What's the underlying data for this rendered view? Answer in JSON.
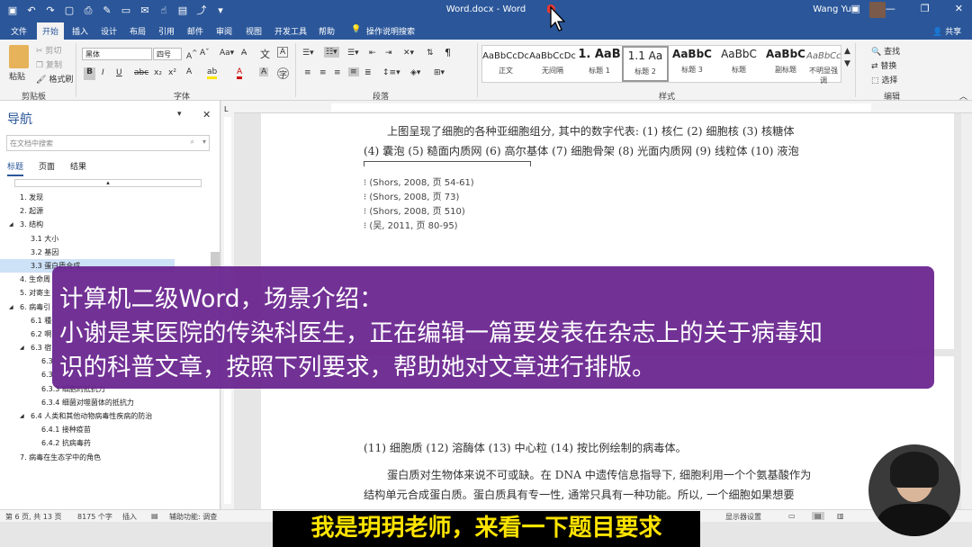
{
  "window": {
    "title": "Word.docx - Word",
    "user": "Wang Yue"
  },
  "ribbon_tabs": [
    "文件",
    "开始",
    "插入",
    "设计",
    "布局",
    "引用",
    "邮件",
    "审阅",
    "视图",
    "开发工具",
    "帮助",
    "操作说明搜索"
  ],
  "share": "共享",
  "clipboard": {
    "paste": "粘贴",
    "cut": "剪切",
    "copy": "复制",
    "painter": "格式刷",
    "label": "剪贴板"
  },
  "font": {
    "name": "黑体",
    "size": "四号",
    "label": "字体"
  },
  "paragraph_label": "段落",
  "styles": {
    "label": "样式",
    "items": [
      {
        "preview": "AaBbCcDc",
        "name": "正文"
      },
      {
        "preview": "AaBbCcDc",
        "name": "无间隔"
      },
      {
        "preview": "1. AaB",
        "name": "标题 1"
      },
      {
        "preview": "1.1 Aa",
        "name": "标题 2"
      },
      {
        "preview": "AaBbC",
        "name": "标题 3"
      },
      {
        "preview": "AaBbC",
        "name": "标题"
      },
      {
        "preview": "AaBbC",
        "name": "副标题"
      },
      {
        "preview": "AaBbCcDi",
        "name": "不明显强调"
      }
    ]
  },
  "editing": {
    "find": "查找",
    "replace": "替换",
    "select": "选择",
    "label": "编辑"
  },
  "nav": {
    "title": "导航",
    "search_placeholder": "在文档中搜索",
    "tabs": [
      "标题",
      "页面",
      "结果"
    ],
    "items": [
      {
        "text": "1. 发现",
        "level": 1
      },
      {
        "text": "2. 起源",
        "level": 1
      },
      {
        "text": "3. 结构",
        "level": 1,
        "expanded": true
      },
      {
        "text": "3.1 大小",
        "level": 2
      },
      {
        "text": "3.2 基因",
        "level": 2
      },
      {
        "text": "3.3 蛋白质合成",
        "level": 2,
        "selected": true
      },
      {
        "text": "4. 生命周",
        "level": 1
      },
      {
        "text": "5. 对寄主",
        "level": 1
      },
      {
        "text": "6. 病毒引",
        "level": 1,
        "expanded": true
      },
      {
        "text": "6.1 種",
        "level": 2
      },
      {
        "text": "6.2 啊",
        "level": 2
      },
      {
        "text": "6.3 宿",
        "level": 2,
        "expanded": true
      },
      {
        "text": "6.3",
        "level": 3
      },
      {
        "text": "6.3",
        "level": 3
      },
      {
        "text": "6.3.3 细胞的抵抗力",
        "level": 3
      },
      {
        "text": "6.3.4 细菌对噬菌体的抵抗力",
        "level": 3
      },
      {
        "text": "6.4 人类和其他动物病毒性疾病的防治",
        "level": 2,
        "expanded": true
      },
      {
        "text": "6.4.1 接种疫苗",
        "level": 3
      },
      {
        "text": "6.4.2 抗病毒药",
        "level": 3
      },
      {
        "text": "7. 病毒在生态学中的角色",
        "level": 1
      }
    ]
  },
  "document": {
    "line1": "上图呈现了细胞的各种亚细胞组分, 其中的数字代表: (1) 核仁 (2) 细胞核 (3) 核糖体",
    "line2": "(4) 囊泡 (5) 糙面内质网 (6) 高尔基体 (7) 细胞骨架 (8) 光面内质网 (9) 线粒体 (10) 液泡",
    "citations": [
      "(Shors, 2008, 页 54-61)",
      "(Shors, 2008, 页 73)",
      "(Shors, 2008, 页 510)",
      "(吴, 2011, 页 80-95)"
    ],
    "line3": "(11) 细胞质 (12) 溶酶体 (13) 中心粒 (14) 按比例绘制的病毒体。",
    "line4": "蛋白质对生物体来说不可或缺。在 DNA 中遗传信息指导下, 细胞利用一个个氨基酸作为",
    "line5": "结构单元合成蛋白质。蛋白质具有专一性, 通常只具有一种功能。所以, 一个细胞如果想要"
  },
  "status": {
    "page": "第 6 页, 共 13 页",
    "words": "8175 个字",
    "mode": "插入",
    "accessibility": "辅助功能: 调查",
    "display": "显示器设置"
  },
  "overlay": {
    "line1": "计算机二级Word，场景介绍：",
    "line2": "小谢是某医院的传染科医生，正在编辑一篇要发表在杂志上的关于病毒知",
    "line3": "识的科普文章，按照下列要求，帮助她对文章进行排版。"
  },
  "caption": "我是玥玥老师，来看一下题目要求"
}
